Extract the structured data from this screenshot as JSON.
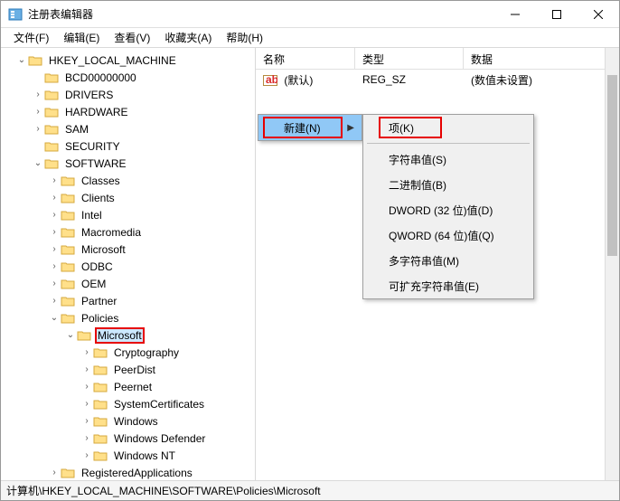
{
  "window": {
    "title": "注册表编辑器"
  },
  "menubar": [
    "文件(F)",
    "编辑(E)",
    "查看(V)",
    "收藏夹(A)",
    "帮助(H)"
  ],
  "tree": [
    {
      "depth": 0,
      "exp": "v",
      "label": "HKEY_LOCAL_MACHINE",
      "sel": false
    },
    {
      "depth": 1,
      "exp": "",
      "label": "BCD00000000",
      "sel": false
    },
    {
      "depth": 1,
      "exp": ">",
      "label": "DRIVERS",
      "sel": false
    },
    {
      "depth": 1,
      "exp": ">",
      "label": "HARDWARE",
      "sel": false
    },
    {
      "depth": 1,
      "exp": ">",
      "label": "SAM",
      "sel": false
    },
    {
      "depth": 1,
      "exp": "",
      "label": "SECURITY",
      "sel": false
    },
    {
      "depth": 1,
      "exp": "v",
      "label": "SOFTWARE",
      "sel": false
    },
    {
      "depth": 2,
      "exp": ">",
      "label": "Classes",
      "sel": false
    },
    {
      "depth": 2,
      "exp": ">",
      "label": "Clients",
      "sel": false
    },
    {
      "depth": 2,
      "exp": ">",
      "label": "Intel",
      "sel": false
    },
    {
      "depth": 2,
      "exp": ">",
      "label": "Macromedia",
      "sel": false
    },
    {
      "depth": 2,
      "exp": ">",
      "label": "Microsoft",
      "sel": false
    },
    {
      "depth": 2,
      "exp": ">",
      "label": "ODBC",
      "sel": false
    },
    {
      "depth": 2,
      "exp": ">",
      "label": "OEM",
      "sel": false
    },
    {
      "depth": 2,
      "exp": ">",
      "label": "Partner",
      "sel": false
    },
    {
      "depth": 2,
      "exp": "v",
      "label": "Policies",
      "sel": false
    },
    {
      "depth": 3,
      "exp": "v",
      "label": "Microsoft",
      "sel": true,
      "hl": true
    },
    {
      "depth": 4,
      "exp": ">",
      "label": "Cryptography",
      "sel": false
    },
    {
      "depth": 4,
      "exp": ">",
      "label": "PeerDist",
      "sel": false
    },
    {
      "depth": 4,
      "exp": ">",
      "label": "Peernet",
      "sel": false
    },
    {
      "depth": 4,
      "exp": ">",
      "label": "SystemCertificates",
      "sel": false
    },
    {
      "depth": 4,
      "exp": ">",
      "label": "Windows",
      "sel": false
    },
    {
      "depth": 4,
      "exp": ">",
      "label": "Windows Defender",
      "sel": false
    },
    {
      "depth": 4,
      "exp": ">",
      "label": "Windows NT",
      "sel": false
    },
    {
      "depth": 2,
      "exp": ">",
      "label": "RegisteredApplications",
      "sel": false
    }
  ],
  "list": {
    "headers": {
      "name": "名称",
      "type": "类型",
      "data": "数据"
    },
    "rows": [
      {
        "icon": "ab",
        "name": "(默认)",
        "type": "REG_SZ",
        "data": "(数值未设置)"
      }
    ]
  },
  "context1": {
    "item": "新建(N)"
  },
  "context2": [
    "项(K)",
    "字符串值(S)",
    "二进制值(B)",
    "DWORD (32 位)值(D)",
    "QWORD (64 位)值(Q)",
    "多字符串值(M)",
    "可扩充字符串值(E)"
  ],
  "statusbar": "计算机\\HKEY_LOCAL_MACHINE\\SOFTWARE\\Policies\\Microsoft"
}
